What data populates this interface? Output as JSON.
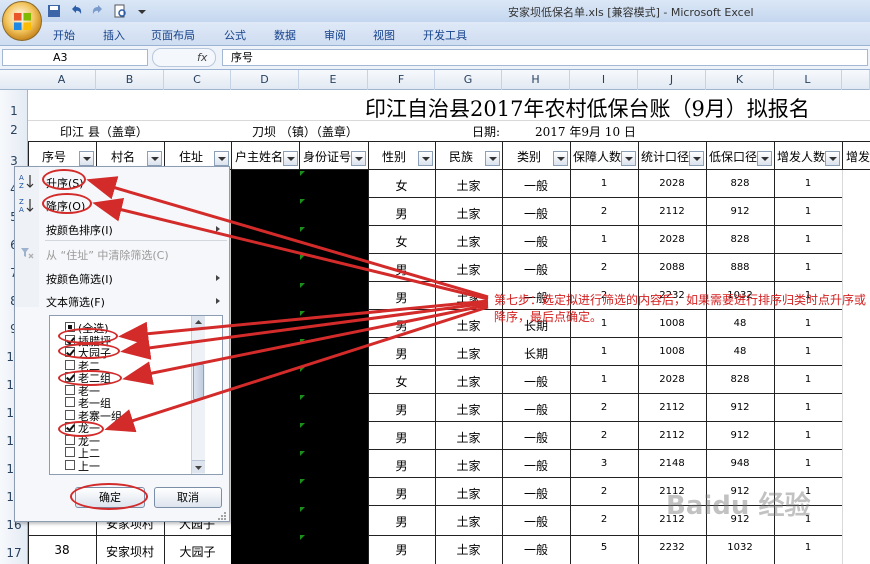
{
  "window": {
    "title": "安家坝低保名单.xls [兼容模式] - Microsoft Excel"
  },
  "ribbon": {
    "tabs": [
      "开始",
      "插入",
      "页面布局",
      "公式",
      "数据",
      "审阅",
      "视图",
      "开发工具"
    ]
  },
  "formula": {
    "name_box": "A3",
    "fx": "fx",
    "content": "序号"
  },
  "columns": [
    "A",
    "B",
    "C",
    "D",
    "E",
    "F",
    "G",
    "H",
    "I",
    "J",
    "K",
    "L"
  ],
  "rows": [
    "1",
    "2",
    "3",
    "4",
    "5",
    "6",
    "7",
    "8",
    "9",
    "10",
    "11",
    "12",
    "13",
    "14",
    "15",
    "16",
    "17"
  ],
  "sheet": {
    "title": "印江自治县2017年农村低保台账（9月）拟报名",
    "county": "印江   县（盖章）",
    "town": "刀坝 （镇）（盖章）",
    "date_label": "日期:",
    "date_value": "2017 年9月 10 日",
    "headers": [
      "序号",
      "村名",
      "住址",
      "户主姓名",
      "身份证号",
      "性别",
      "民族",
      "类别",
      "保障人数",
      "统计口径",
      "低保口径",
      "增发人数",
      "增发"
    ],
    "data": [
      [
        "女",
        "土家",
        "一般",
        "1",
        "2028",
        "828",
        "1"
      ],
      [
        "男",
        "土家",
        "一般",
        "2",
        "2112",
        "912",
        "1"
      ],
      [
        "女",
        "土家",
        "一般",
        "1",
        "2028",
        "828",
        "1"
      ],
      [
        "男",
        "土家",
        "一般",
        "2",
        "2088",
        "888",
        "1"
      ],
      [
        "男",
        "土家",
        "一般",
        "2",
        "2232",
        "1032",
        "1"
      ],
      [
        "男",
        "土家",
        "长期",
        "1",
        "1008",
        "48",
        "1"
      ],
      [
        "男",
        "土家",
        "长期",
        "1",
        "1008",
        "48",
        "1"
      ],
      [
        "女",
        "土家",
        "一般",
        "1",
        "2028",
        "828",
        "1"
      ],
      [
        "男",
        "土家",
        "一般",
        "2",
        "2112",
        "912",
        "1"
      ],
      [
        "男",
        "土家",
        "一般",
        "2",
        "2112",
        "912",
        "1"
      ],
      [
        "男",
        "土家",
        "一般",
        "3",
        "2148",
        "948",
        "1"
      ],
      [
        "男",
        "土家",
        "一般",
        "2",
        "2112",
        "912",
        "1"
      ],
      [
        "男",
        "土家",
        "一般",
        "2",
        "2112",
        "912",
        "1"
      ],
      [
        "男",
        "土家",
        "一般",
        "5",
        "2232",
        "1032",
        "1"
      ]
    ],
    "row16_partial": {
      "village": "安家坝村",
      "address": "大园子"
    },
    "row17": {
      "no": "38",
      "village": "安家坝村",
      "address": "大园子"
    }
  },
  "filter_menu": {
    "sort_asc": "升序(S)",
    "sort_desc": "降序(O)",
    "sort_color": "按颜色排序(I)",
    "clear_filter": "从 “住址” 中清除筛选(C)",
    "filter_color": "按颜色筛选(I)",
    "text_filter": "文本筛选(F)",
    "items": [
      {
        "label": "(全选)",
        "state": "part"
      },
      {
        "label": "插腊坪",
        "state": "on"
      },
      {
        "label": "大园子",
        "state": "on"
      },
      {
        "label": "老二",
        "state": "off"
      },
      {
        "label": "老二组",
        "state": "on"
      },
      {
        "label": "老一",
        "state": "off"
      },
      {
        "label": "老一组",
        "state": "off"
      },
      {
        "label": "老寨一组",
        "state": "off"
      },
      {
        "label": "龙一",
        "state": "on"
      },
      {
        "label": "龙一",
        "state": "off"
      },
      {
        "label": "上二",
        "state": "off"
      },
      {
        "label": "上一",
        "state": "off"
      }
    ],
    "ok": "确定",
    "cancel": "取消"
  },
  "annotation": "第七步：选定拟进行筛选的内容后，如果需要进行排序归类时点升序或降序，最后点确定。",
  "watermark": "Baidu 经验",
  "colors": {
    "annotation": "#d42020",
    "arrow": "#d32a2a"
  }
}
